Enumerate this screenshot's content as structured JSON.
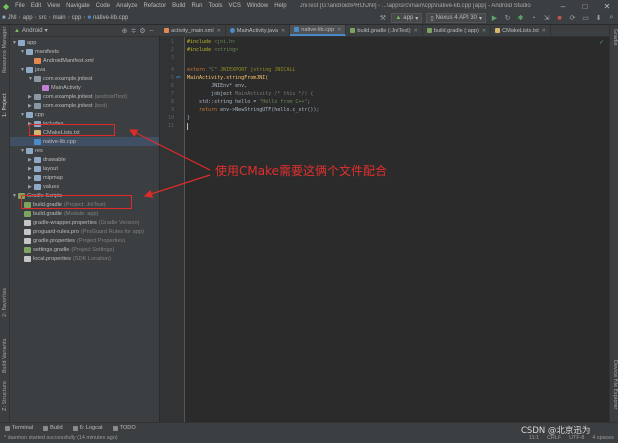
{
  "menubar": {
    "app_icon": "android-studio-icon",
    "items": [
      "File",
      "Edit",
      "View",
      "Navigate",
      "Code",
      "Analyze",
      "Refactor",
      "Build",
      "Run",
      "Tools",
      "VCS",
      "Window",
      "Help"
    ],
    "title": "JniTest [G:\\android\\PRO\\JNI] - ...\\app\\src\\main\\cpp\\native-lib.cpp [app] - Android Studio"
  },
  "navbar": {
    "breadcrumbs": [
      "JNI",
      "app",
      "src",
      "main",
      "cpp",
      "native-lib.cpp"
    ],
    "run_config": "app",
    "device": "Nexus 4 API 30"
  },
  "project_panel": {
    "view_selector": "Android",
    "tree": [
      {
        "label": "app",
        "sub": "",
        "icon": "folder"
      },
      {
        "label": "manifests",
        "sub": "",
        "icon": "folder"
      },
      {
        "label": "AndroidManifest.xml",
        "sub": "",
        "icon": "xml"
      },
      {
        "label": "java",
        "sub": "",
        "icon": "folder"
      },
      {
        "label": "com.example.jnitest",
        "sub": "",
        "icon": "pkg"
      },
      {
        "label": "MainActivity",
        "sub": "",
        "icon": "kt"
      },
      {
        "label": "com.example.jnitest",
        "sub": "(androidTest)",
        "icon": "pkg"
      },
      {
        "label": "com.example.jnitest",
        "sub": "(test)",
        "icon": "pkg"
      },
      {
        "label": "cpp",
        "sub": "",
        "icon": "folder"
      },
      {
        "label": "includes",
        "sub": "",
        "icon": "folder"
      },
      {
        "label": "CMakeLists.txt",
        "sub": "",
        "icon": "cmake"
      },
      {
        "label": "native-lib.cpp",
        "sub": "",
        "icon": "cpp"
      },
      {
        "label": "res",
        "sub": "",
        "icon": "folder"
      },
      {
        "label": "drawable",
        "sub": "",
        "icon": "folder"
      },
      {
        "label": "layout",
        "sub": "",
        "icon": "folder"
      },
      {
        "label": "mipmap",
        "sub": "",
        "icon": "folder"
      },
      {
        "label": "values",
        "sub": "",
        "icon": "folder"
      },
      {
        "label": "Gradle Scripts",
        "sub": "",
        "icon": "gradle"
      },
      {
        "label": "build.gradle",
        "sub": "(Project: JniTest)",
        "icon": "gradle"
      },
      {
        "label": "build.gradle",
        "sub": "(Module: app)",
        "icon": "gradle"
      },
      {
        "label": "gradle-wrapper.properties",
        "sub": "(Gradle Version)",
        "icon": "file"
      },
      {
        "label": "proguard-rules.pro",
        "sub": "(ProGuard Rules for app)",
        "icon": "file"
      },
      {
        "label": "gradle.properties",
        "sub": "(Project Properties)",
        "icon": "file"
      },
      {
        "label": "settings.gradle",
        "sub": "(Project Settings)",
        "icon": "gradle"
      },
      {
        "label": "local.properties",
        "sub": "(SDK Location)",
        "icon": "file"
      }
    ]
  },
  "tabs": [
    {
      "label": "activity_main.xml",
      "active": false
    },
    {
      "label": "MainActivity.java",
      "active": false
    },
    {
      "label": "native-lib.cpp",
      "active": true
    },
    {
      "label": "build.gradle (:JniTest)",
      "active": false
    },
    {
      "label": "build.gradle (:app)",
      "active": false
    },
    {
      "label": "CMakeLists.txt",
      "active": false
    }
  ],
  "editor": {
    "line_numbers": [
      "1",
      "2",
      "3",
      "4",
      "5",
      "6",
      "7",
      "8",
      "9",
      "10",
      "11"
    ],
    "lines": {
      "l1_kw": "#include",
      "l1_rest": " <jni.h>",
      "l2_kw": "#include",
      "l2_rest": " <string>",
      "l4_a": "extern ",
      "l4_b": "\"C\"",
      "l4_c": " JNIEXPORT jstring JNICALL",
      "l5": "MainActivity.stringFromJNI(",
      "l6": "        JNIEnv* env,",
      "l7_a": "        jobject ",
      "l7_hint": "MainActivity",
      "l7_b": " /* this */) {",
      "l8_a": "    std::string hello = ",
      "l8_str": "\"Hello from C++\"",
      "l8_b": ";",
      "l9_a": "    ",
      "l9_kw": "return",
      "l9_b": " env->NewStringUTF(hello.c_str());",
      "l10": "}"
    }
  },
  "left_stripe": [
    "Resource Manager",
    "1: Project",
    "2: Favorites",
    "Build Variants",
    "Z: Structure"
  ],
  "right_stripe": [
    "Gradle",
    "Device File Explorer"
  ],
  "toolwindows": [
    "Terminal",
    "Build",
    "6: Logcat",
    "TODO"
  ],
  "status": {
    "message": "* daemon started successfully (14 minutes ago)",
    "position": "11:1",
    "line_sep": "CRLF",
    "encoding": "UTF-8",
    "indent": "4 spaces"
  },
  "annotation": {
    "text": "使用CMake需要这俩个文件配合",
    "color": "#e32f2f"
  },
  "watermark": "CSDN @北京迅为"
}
